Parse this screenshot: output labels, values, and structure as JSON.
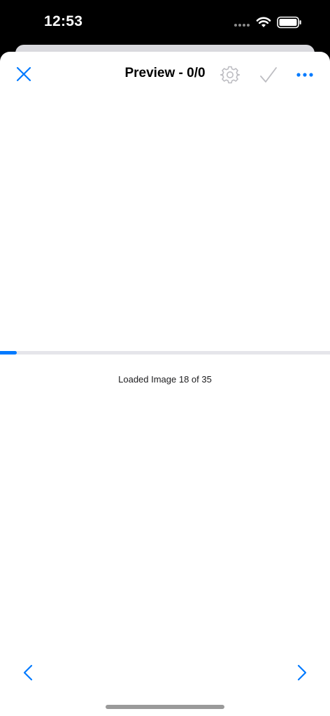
{
  "status_bar": {
    "time": "12:53",
    "icons": [
      "cellular-dots-icon",
      "wifi-icon",
      "battery-icon"
    ]
  },
  "nav": {
    "title": "Preview - 0/0",
    "close_icon": "close-icon",
    "settings_icon": "gear-icon",
    "confirm_icon": "checkmark-icon",
    "more_icon": "ellipsis-icon"
  },
  "progress": {
    "value": 0.05,
    "status_text": "Loaded Image 18 of 35"
  },
  "footer": {
    "prev_icon": "chevron-left-icon",
    "next_icon": "chevron-right-icon"
  },
  "colors": {
    "accent": "#007aff",
    "disabled": "#bdbdc2",
    "track": "#e5e5ea"
  }
}
